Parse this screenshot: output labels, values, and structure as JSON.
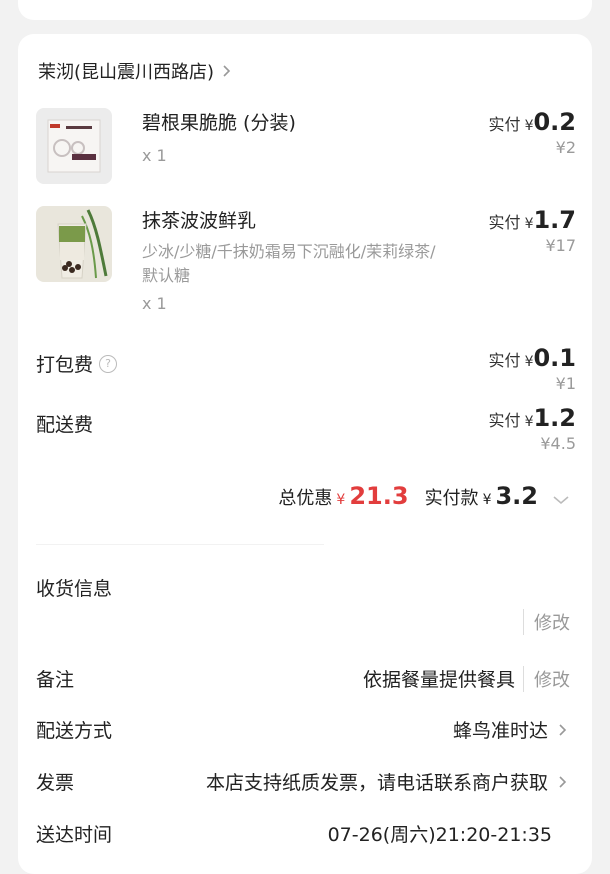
{
  "store": {
    "name": "茉沏(昆山震川西路店)"
  },
  "items": [
    {
      "name": "碧根果脆脆 (分装)",
      "spec": "",
      "qty": "x 1",
      "paid_label": "实付",
      "yen": "¥",
      "paid": "0.2",
      "original": "¥2"
    },
    {
      "name": "抹茶波波鲜乳",
      "spec": "少冰/少糖/千抹奶霜易下沉融化/茉莉绿茶/默认糖",
      "qty": "x 1",
      "paid_label": "实付",
      "yen": "¥",
      "paid": "1.7",
      "original": "¥17"
    }
  ],
  "fees": [
    {
      "label": "打包费",
      "paid_label": "实付",
      "yen": "¥",
      "paid": "0.1",
      "original": "¥1"
    },
    {
      "label": "配送费",
      "paid_label": "实付",
      "yen": "¥",
      "paid": "1.2",
      "original": "¥4.5"
    }
  ],
  "total": {
    "discount_label": "总优惠",
    "yen": "¥",
    "discount": "21.3",
    "paid_label": "实付款",
    "paid": "3.2"
  },
  "info": {
    "receive_label": "收货信息",
    "edit_label": "修改",
    "remark_label": "备注",
    "remark_value": "依据餐量提供餐具",
    "delivery_label": "配送方式",
    "delivery_value": "蜂鸟准时达",
    "invoice_label": "发票",
    "invoice_value": "本店支持纸质发票，请电话联系商户获取",
    "time_label": "送达时间",
    "time_value": "07-26(周六)21:20-21:35"
  },
  "colors": {
    "accent_red": "#e23d3d",
    "muted": "#9a9a9a"
  }
}
